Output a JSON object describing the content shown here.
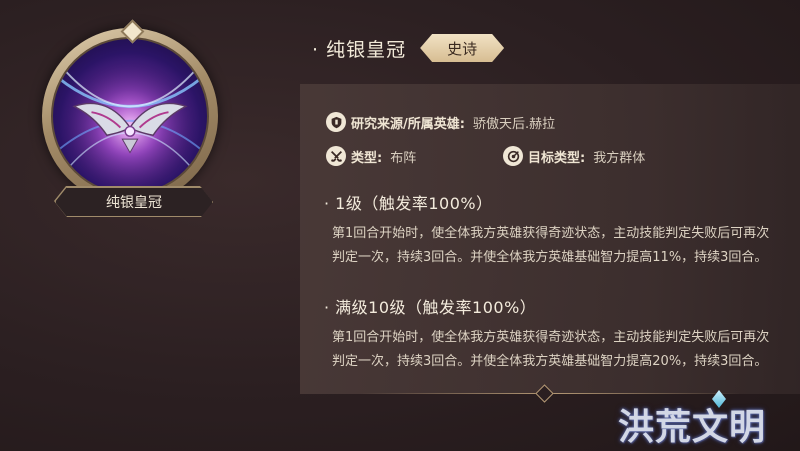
{
  "item": {
    "name": "纯银皇冠",
    "plate_name": "纯银皇冠",
    "rarity": "史诗"
  },
  "info": {
    "source_label": "研究来源/所属英雄:",
    "source_value": "骄傲天后.赫拉",
    "type_label": "类型:",
    "type_value": "布阵",
    "target_label": "目标类型:",
    "target_value": "我方群体"
  },
  "levels": [
    {
      "heading": "· 1级（触发率100%）",
      "description": "第1回合开始时，使全体我方英雄获得奇迹状态，主动技能判定失败后可再次判定一次，持续3回合。并使全体我方英雄基础智力提高11%，持续3回合。"
    },
    {
      "heading": "· 满级10级（触发率100%）",
      "description": "第1回合开始时，使全体我方英雄获得奇迹状态，主动技能判定失败后可再次判定一次，持续3回合。并使全体我方英雄基础智力提高20%，持续3回合。"
    }
  ],
  "logo": {
    "text": "洪荒文明"
  },
  "icons": {
    "source": "shield-icon",
    "type": "crossed-swords-icon",
    "target": "target-icon"
  },
  "colors": {
    "background": "#2b1f21",
    "panel": "#4a3a38",
    "gold": "#a08b6a",
    "rarity_badge": "#e8d4b0"
  }
}
